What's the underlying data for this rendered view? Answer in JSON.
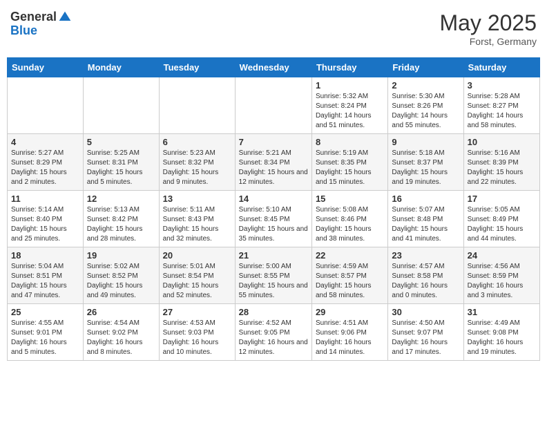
{
  "logo": {
    "general": "General",
    "blue": "Blue"
  },
  "title": {
    "month_year": "May 2025",
    "location": "Forst, Germany"
  },
  "headers": [
    "Sunday",
    "Monday",
    "Tuesday",
    "Wednesday",
    "Thursday",
    "Friday",
    "Saturday"
  ],
  "weeks": [
    [
      {
        "day": "",
        "info": ""
      },
      {
        "day": "",
        "info": ""
      },
      {
        "day": "",
        "info": ""
      },
      {
        "day": "",
        "info": ""
      },
      {
        "day": "1",
        "info": "Sunrise: 5:32 AM\nSunset: 8:24 PM\nDaylight: 14 hours and 51 minutes."
      },
      {
        "day": "2",
        "info": "Sunrise: 5:30 AM\nSunset: 8:26 PM\nDaylight: 14 hours and 55 minutes."
      },
      {
        "day": "3",
        "info": "Sunrise: 5:28 AM\nSunset: 8:27 PM\nDaylight: 14 hours and 58 minutes."
      }
    ],
    [
      {
        "day": "4",
        "info": "Sunrise: 5:27 AM\nSunset: 8:29 PM\nDaylight: 15 hours and 2 minutes."
      },
      {
        "day": "5",
        "info": "Sunrise: 5:25 AM\nSunset: 8:31 PM\nDaylight: 15 hours and 5 minutes."
      },
      {
        "day": "6",
        "info": "Sunrise: 5:23 AM\nSunset: 8:32 PM\nDaylight: 15 hours and 9 minutes."
      },
      {
        "day": "7",
        "info": "Sunrise: 5:21 AM\nSunset: 8:34 PM\nDaylight: 15 hours and 12 minutes."
      },
      {
        "day": "8",
        "info": "Sunrise: 5:19 AM\nSunset: 8:35 PM\nDaylight: 15 hours and 15 minutes."
      },
      {
        "day": "9",
        "info": "Sunrise: 5:18 AM\nSunset: 8:37 PM\nDaylight: 15 hours and 19 minutes."
      },
      {
        "day": "10",
        "info": "Sunrise: 5:16 AM\nSunset: 8:39 PM\nDaylight: 15 hours and 22 minutes."
      }
    ],
    [
      {
        "day": "11",
        "info": "Sunrise: 5:14 AM\nSunset: 8:40 PM\nDaylight: 15 hours and 25 minutes."
      },
      {
        "day": "12",
        "info": "Sunrise: 5:13 AM\nSunset: 8:42 PM\nDaylight: 15 hours and 28 minutes."
      },
      {
        "day": "13",
        "info": "Sunrise: 5:11 AM\nSunset: 8:43 PM\nDaylight: 15 hours and 32 minutes."
      },
      {
        "day": "14",
        "info": "Sunrise: 5:10 AM\nSunset: 8:45 PM\nDaylight: 15 hours and 35 minutes."
      },
      {
        "day": "15",
        "info": "Sunrise: 5:08 AM\nSunset: 8:46 PM\nDaylight: 15 hours and 38 minutes."
      },
      {
        "day": "16",
        "info": "Sunrise: 5:07 AM\nSunset: 8:48 PM\nDaylight: 15 hours and 41 minutes."
      },
      {
        "day": "17",
        "info": "Sunrise: 5:05 AM\nSunset: 8:49 PM\nDaylight: 15 hours and 44 minutes."
      }
    ],
    [
      {
        "day": "18",
        "info": "Sunrise: 5:04 AM\nSunset: 8:51 PM\nDaylight: 15 hours and 47 minutes."
      },
      {
        "day": "19",
        "info": "Sunrise: 5:02 AM\nSunset: 8:52 PM\nDaylight: 15 hours and 49 minutes."
      },
      {
        "day": "20",
        "info": "Sunrise: 5:01 AM\nSunset: 8:54 PM\nDaylight: 15 hours and 52 minutes."
      },
      {
        "day": "21",
        "info": "Sunrise: 5:00 AM\nSunset: 8:55 PM\nDaylight: 15 hours and 55 minutes."
      },
      {
        "day": "22",
        "info": "Sunrise: 4:59 AM\nSunset: 8:57 PM\nDaylight: 15 hours and 58 minutes."
      },
      {
        "day": "23",
        "info": "Sunrise: 4:57 AM\nSunset: 8:58 PM\nDaylight: 16 hours and 0 minutes."
      },
      {
        "day": "24",
        "info": "Sunrise: 4:56 AM\nSunset: 8:59 PM\nDaylight: 16 hours and 3 minutes."
      }
    ],
    [
      {
        "day": "25",
        "info": "Sunrise: 4:55 AM\nSunset: 9:01 PM\nDaylight: 16 hours and 5 minutes."
      },
      {
        "day": "26",
        "info": "Sunrise: 4:54 AM\nSunset: 9:02 PM\nDaylight: 16 hours and 8 minutes."
      },
      {
        "day": "27",
        "info": "Sunrise: 4:53 AM\nSunset: 9:03 PM\nDaylight: 16 hours and 10 minutes."
      },
      {
        "day": "28",
        "info": "Sunrise: 4:52 AM\nSunset: 9:05 PM\nDaylight: 16 hours and 12 minutes."
      },
      {
        "day": "29",
        "info": "Sunrise: 4:51 AM\nSunset: 9:06 PM\nDaylight: 16 hours and 14 minutes."
      },
      {
        "day": "30",
        "info": "Sunrise: 4:50 AM\nSunset: 9:07 PM\nDaylight: 16 hours and 17 minutes."
      },
      {
        "day": "31",
        "info": "Sunrise: 4:49 AM\nSunset: 9:08 PM\nDaylight: 16 hours and 19 minutes."
      }
    ]
  ]
}
